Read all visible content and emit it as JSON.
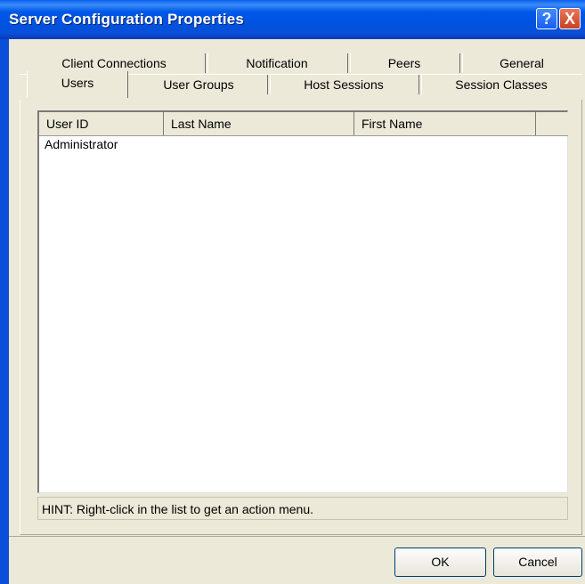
{
  "window": {
    "title": "Server Configuration Properties"
  },
  "titlebar_buttons": {
    "help": "?",
    "close": "X"
  },
  "tabs_back_row": [
    "Client Connections",
    "Notification",
    "Peers",
    "General"
  ],
  "tabs_front_row": [
    "Users",
    "User Groups",
    "Host Sessions",
    "Session Classes"
  ],
  "active_tab": "Users",
  "list": {
    "columns": [
      "User ID",
      "Last Name",
      "First Name",
      ""
    ],
    "rows": [
      {
        "user_id": "Administrator",
        "last_name": "",
        "first_name": ""
      }
    ]
  },
  "hint": "HINT: Right-click in the list to get an action menu.",
  "buttons": {
    "ok": "OK",
    "cancel": "Cancel"
  }
}
